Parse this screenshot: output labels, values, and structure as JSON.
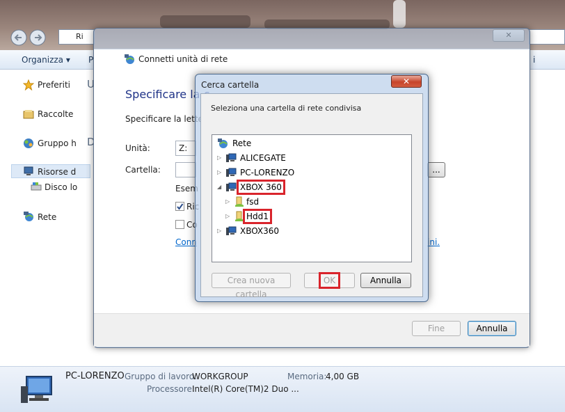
{
  "explorer": {
    "address_text": "Ri",
    "toolbar": {
      "organize": "Organizza",
      "org_arrow": "▾",
      "extra": "P",
      "right_text": "i"
    },
    "nav_items": [
      {
        "label": "Preferiti",
        "icon": "star-icon"
      },
      {
        "label": "Raccolte",
        "icon": "library-icon"
      },
      {
        "label": "Gruppo h",
        "icon": "homegroup-icon"
      },
      {
        "label": "Risorse d",
        "icon": "computer-icon"
      },
      {
        "label": "Disco lo",
        "icon": "disk-icon"
      },
      {
        "label": "Rete",
        "icon": "network-icon"
      }
    ],
    "main_partial": {
      "u": "U",
      "d": "D"
    },
    "details": {
      "computer_name": "PC-LORENZO",
      "workgroup_label": "Gruppo di lavoro:",
      "workgroup_value": "WORKGROUP",
      "memory_label": "Memoria:",
      "memory_value": "4,00 GB",
      "processor_label": "Processore:",
      "processor_value": "Intel(R) Core(TM)2 Duo ..."
    }
  },
  "wizard": {
    "title": "Connetti unità di rete",
    "heading": "Specificare la c",
    "instruction": "Specificare la lettera",
    "drive_label": "Unità:",
    "drive_value": "Z:",
    "folder_label": "Cartella:",
    "example_label": "Esem",
    "reconnect_label": "Ric",
    "credentials_label": "Co",
    "link_left": "Conn",
    "link_right": "ini.",
    "finish_label": "Fine",
    "cancel_label": "Annulla",
    "browse_label": "..."
  },
  "dialog": {
    "title": "Cerca cartella",
    "close_label": "✕",
    "instruction": "Seleziona una cartella di rete condivisa",
    "tree": [
      {
        "label": "Rete",
        "level": 0,
        "expander": "",
        "icon": "network-icon"
      },
      {
        "label": "ALICEGATE",
        "level": 1,
        "expander": "▷",
        "icon": "computer-icon"
      },
      {
        "label": "PC-LORENZO",
        "level": 1,
        "expander": "▷",
        "icon": "computer-icon"
      },
      {
        "label": "XBOX 360",
        "level": 1,
        "expander": "◢",
        "icon": "computer-icon"
      },
      {
        "label": "fsd",
        "level": 2,
        "expander": "▷",
        "icon": "share-folder-icon"
      },
      {
        "label": "Hdd1",
        "level": 2,
        "expander": "▷",
        "icon": "share-folder-icon"
      },
      {
        "label": "XBOX360",
        "level": 1,
        "expander": "▷",
        "icon": "computer-icon"
      }
    ],
    "new_folder_label": "Crea nuova cartella",
    "ok_label": "OK",
    "cancel_label": "Annulla"
  }
}
